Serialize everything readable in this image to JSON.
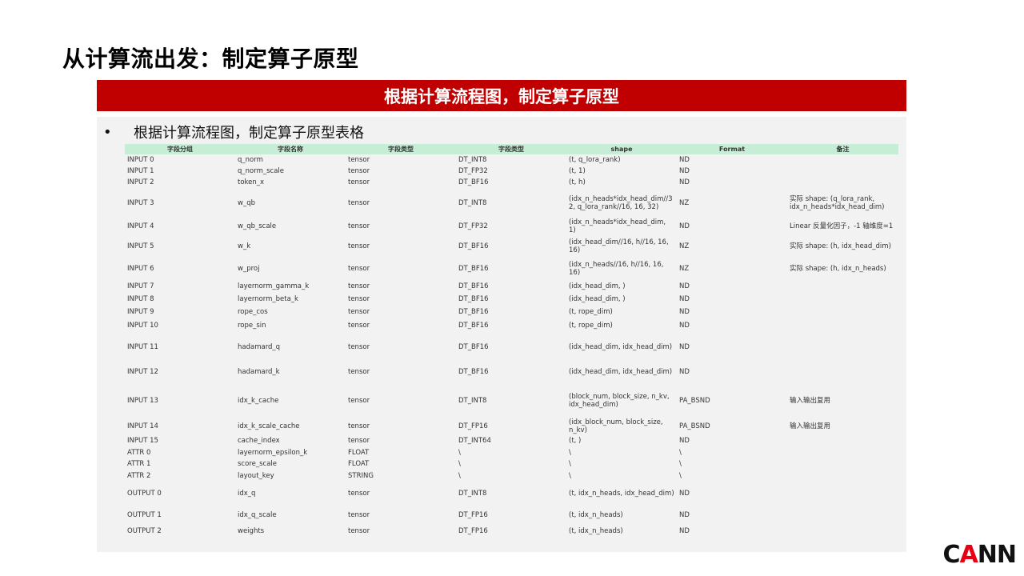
{
  "slide": {
    "title": "从计算流出发：制定算子原型",
    "banner": "根据计算流程图，制定算子原型",
    "bullet_mark": "•",
    "bullet_text": "根据计算流程图，制定算子原型表格"
  },
  "table": {
    "headers": [
      "字段分组",
      "字段名称",
      "字段类型",
      "字段类型",
      "shape",
      "Format",
      "备注"
    ],
    "rows": [
      {
        "group": "INPUT 0",
        "name": "q_norm",
        "type": "tensor",
        "dtype": "DT_INT8",
        "shape": "(t, q_lora_rank)",
        "format": "ND",
        "note": ""
      },
      {
        "group": "INPUT 1",
        "name": "q_norm_scale",
        "type": "tensor",
        "dtype": "DT_FP32",
        "shape": "(t, 1)",
        "format": "ND",
        "note": ""
      },
      {
        "group": "INPUT 2",
        "name": "token_x",
        "type": "tensor",
        "dtype": "DT_BF16",
        "shape": "(t, h)",
        "format": "ND",
        "note": ""
      },
      {
        "group": "INPUT 3",
        "name": "w_qb",
        "type": "tensor",
        "dtype": "DT_INT8",
        "shape": "(idx_n_heads*idx_head_dim//32, q_lora_rank//16, 16, 32)",
        "format": "NZ",
        "note": "实际 shape: (q_lora_rank, idx_n_heads*idx_head_dim)"
      },
      {
        "group": "INPUT 4",
        "name": "w_qb_scale",
        "type": "tensor",
        "dtype": "DT_FP32",
        "shape": "(idx_n_heads*idx_head_dim, 1)",
        "format": "ND",
        "note": "Linear 反量化因子，-1 轴维度=1"
      },
      {
        "group": "INPUT 5",
        "name": "w_k",
        "type": "tensor",
        "dtype": "DT_BF16",
        "shape": "(idx_head_dim//16, h//16, 16, 16)",
        "format": "NZ",
        "note": "实际 shape: (h, idx_head_dim)"
      },
      {
        "group": "INPUT 6",
        "name": "w_proj",
        "type": "tensor",
        "dtype": "DT_BF16",
        "shape": "(idx_n_heads//16, h//16, 16, 16)",
        "format": "NZ",
        "note": "实际 shape: (h, idx_n_heads)"
      },
      {
        "group": "INPUT 7",
        "name": "layernorm_gamma_k",
        "type": "tensor",
        "dtype": "DT_BF16",
        "shape": "(idx_head_dim, )",
        "format": "ND",
        "note": ""
      },
      {
        "group": "INPUT 8",
        "name": "layernorm_beta_k",
        "type": "tensor",
        "dtype": "DT_BF16",
        "shape": "(idx_head_dim, )",
        "format": "ND",
        "note": ""
      },
      {
        "group": "INPUT 9",
        "name": "rope_cos",
        "type": "tensor",
        "dtype": "DT_BF16",
        "shape": "(t, rope_dim)",
        "format": "ND",
        "note": ""
      },
      {
        "group": "INPUT 10",
        "name": "rope_sin",
        "type": "tensor",
        "dtype": "DT_BF16",
        "shape": "(t, rope_dim)",
        "format": "ND",
        "note": ""
      },
      {
        "group": "INPUT 11",
        "name": "hadamard_q",
        "type": "tensor",
        "dtype": "DT_BF16",
        "shape": "(idx_head_dim, idx_head_dim)",
        "format": "ND",
        "note": ""
      },
      {
        "group": "INPUT 12",
        "name": "hadamard_k",
        "type": "tensor",
        "dtype": "DT_BF16",
        "shape": "(idx_head_dim, idx_head_dim)",
        "format": "ND",
        "note": ""
      },
      {
        "group": "INPUT 13",
        "name": "idx_k_cache",
        "type": "tensor",
        "dtype": "DT_INT8",
        "shape": "(block_num, block_size, n_kv, idx_head_dim)",
        "format": "PA_BSND",
        "note": "输入输出复用"
      },
      {
        "group": "INPUT 14",
        "name": "idx_k_scale_cache",
        "type": "tensor",
        "dtype": "DT_FP16",
        "shape": "(idx_block_num, block_size, n_kv)",
        "format": "PA_BSND",
        "note": "输入输出复用"
      },
      {
        "group": "INPUT 15",
        "name": "cache_index",
        "type": "tensor",
        "dtype": "DT_INT64",
        "shape": "(t, )",
        "format": "ND",
        "note": ""
      },
      {
        "group": "ATTR 0",
        "name": "layernorm_epsilon_k",
        "type": "FLOAT",
        "dtype": "\\",
        "shape": "\\",
        "format": "\\",
        "note": ""
      },
      {
        "group": "ATTR 1",
        "name": "score_scale",
        "type": "FLOAT",
        "dtype": "\\",
        "shape": "\\",
        "format": "\\",
        "note": ""
      },
      {
        "group": "ATTR 2",
        "name": "layout_key",
        "type": "STRING",
        "dtype": "\\",
        "shape": "\\",
        "format": "\\",
        "note": ""
      },
      {
        "group": "OUTPUT 0",
        "name": "idx_q",
        "type": "tensor",
        "dtype": "DT_INT8",
        "shape": "(t, idx_n_heads, idx_head_dim)",
        "format": "ND",
        "note": ""
      },
      {
        "group": "OUTPUT 1",
        "name": "idx_q_scale",
        "type": "tensor",
        "dtype": "DT_FP16",
        "shape": "(t, idx_n_heads)",
        "format": "ND",
        "note": ""
      },
      {
        "group": "OUTPUT 2",
        "name": "weights",
        "type": "tensor",
        "dtype": "DT_FP16",
        "shape": "(t, idx_n_heads)",
        "format": "ND",
        "note": ""
      }
    ]
  },
  "logo": {
    "text": "CANN",
    "colors": {
      "letters": "#111111",
      "accent": "#e60012"
    }
  },
  "colors": {
    "banner": "#c00000",
    "header_fill": "#c6eed6",
    "panel": "#f2f2f2"
  }
}
